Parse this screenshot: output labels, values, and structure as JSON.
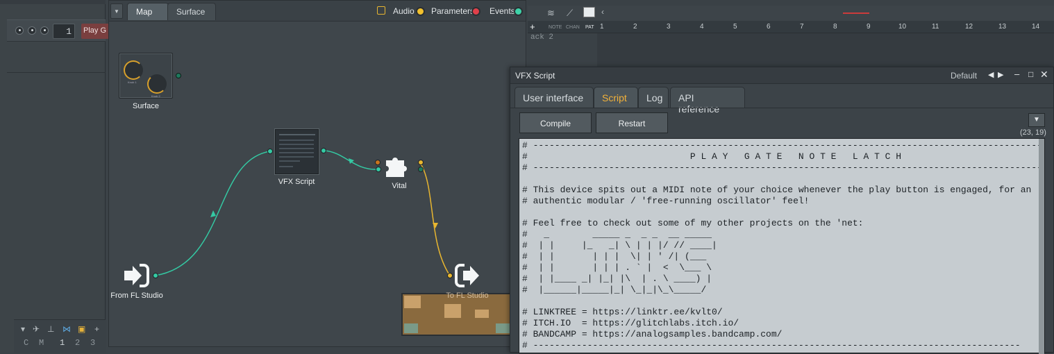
{
  "left_panel": {
    "channel_number": "1",
    "channel_name": "Play G",
    "mode_letters": [
      "C",
      "M"
    ],
    "mode_numbers": [
      "1",
      "2",
      "3"
    ]
  },
  "patcher": {
    "tabs": [
      "Map",
      "Surface"
    ],
    "filters": [
      {
        "label": "Audio",
        "color": "#f2c12e"
      },
      {
        "label": "Parameters",
        "color": "#e0404a"
      },
      {
        "label": "Events",
        "color": "#3ed2a8"
      }
    ],
    "nodes": {
      "surface": "Surface",
      "surface_knob1": "Knob 1",
      "surface_knob2": "Knob 2",
      "vfx": "VFX Script",
      "vital": "Vital",
      "from": "From FL Studio",
      "to": "To FL Studio"
    },
    "colors": {
      "event_wire": "#34c9a3",
      "audio_wire": "#e8b630"
    }
  },
  "playlist": {
    "tool_labels": [
      "NOTE",
      "CHAN",
      "PAT"
    ],
    "track_label": "ack 2",
    "ruler": [
      "1",
      "2",
      "3",
      "4",
      "5",
      "6",
      "7",
      "8",
      "9",
      "10",
      "11",
      "12",
      "13",
      "14"
    ]
  },
  "vfx_window": {
    "title": "VFX Script",
    "preset": "Default",
    "tabs": [
      "User interface",
      "Script",
      "Log",
      "API reference"
    ],
    "active_tab": "Script",
    "buttons": {
      "compile": "Compile",
      "restart": "Restart"
    },
    "cursor_pos": "(23, 19)",
    "code_lines": [
      "# --------------------------------------------------------------------------------------------------",
      "#                              P L A Y   G A T E   N O T E   L A T C H",
      "# --------------------------------------------------------------------------------------------------",
      "",
      "# This device spits out a MIDI note of your choice whenever the play button is engaged, for an",
      "# authentic modular / 'free-running oscillator' feel!",
      "",
      "# Feel free to check out some of my other projects on the 'net:",
      "#   _        _____ _  _ _  __ _____",
      "#  | |     |_   _| \\ | | |/ // ____|",
      "#  | |       | | |  \\| | ' /| (___",
      "#  | |       | | | . ` |  <  \\___ \\",
      "#  | |____ _| |_| |\\  | . \\ ____) |",
      "#  |______|_____|_| \\_|_|\\_\\_____/",
      "",
      "# LINKTREE = https://linktr.ee/kvlt0/",
      "# ITCH.IO  = https://glitchlabs.itch.io/",
      "# BANDCAMP = https://analogsamples.bandcamp.com/",
      "# ------------------------------------------------------------------------------------------"
    ]
  }
}
